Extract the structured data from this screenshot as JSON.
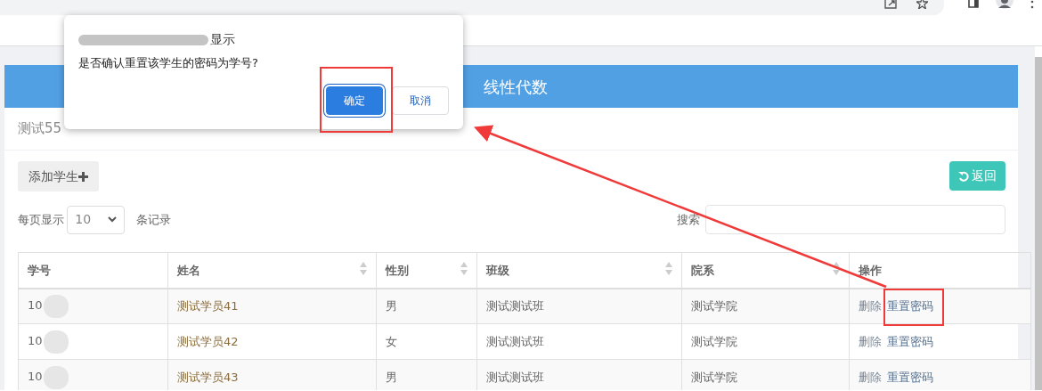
{
  "dialog": {
    "title": "显示",
    "message": "是否确认重置该学生的密码为学号?",
    "buttons": [
      {
        "label": "确定",
        "kind": "primary",
        "focused": true
      },
      {
        "label": "取消",
        "kind": "secondary",
        "focused": false
      }
    ]
  },
  "page": {
    "header_title": "线性代数",
    "subtitle": "测试55",
    "add_button": "添加学生",
    "back_button": "返回",
    "length": {
      "prefix": "每页显示",
      "value": "10",
      "suffix": "条记录"
    },
    "search": {
      "label": "搜索"
    }
  },
  "table": {
    "columns": [
      {
        "label": "学号",
        "sortable": false
      },
      {
        "label": "姓名",
        "sortable": true
      },
      {
        "label": "性别",
        "sortable": true
      },
      {
        "label": "班级",
        "sortable": true
      },
      {
        "label": "院系",
        "sortable": true
      },
      {
        "label": "操作",
        "sortable": false
      }
    ],
    "rows": [
      {
        "cells": [
          "10",
          "测试学员41",
          "男",
          "测试测试班",
          "测试学院"
        ],
        "actions": [
          "删除",
          "重置密码"
        ]
      },
      {
        "cells": [
          "10",
          "测试学员42",
          "女",
          "测试测试班",
          "测试学院"
        ],
        "actions": [
          "删除",
          "重置密码"
        ]
      },
      {
        "cells": [
          "10",
          "测试学员43",
          "男",
          "测试测试班",
          "测试学院"
        ],
        "actions": [
          "删除",
          "重置密码"
        ]
      }
    ]
  }
}
